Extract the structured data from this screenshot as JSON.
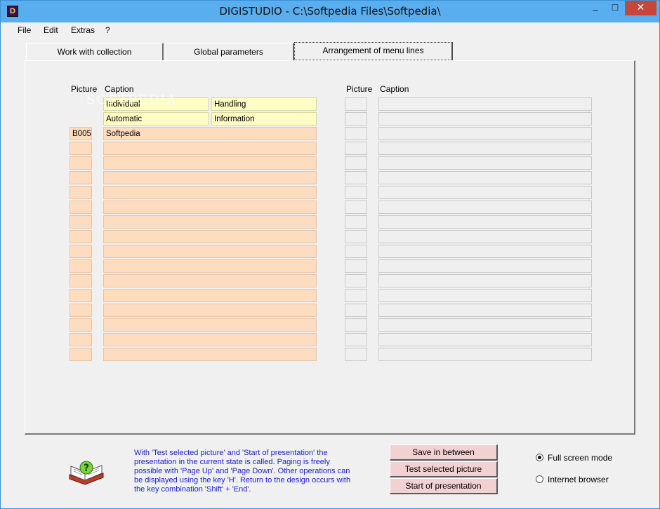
{
  "window": {
    "title": "DIGISTUDIO - C:\\Softpedia Files\\Softpedia\\"
  },
  "menu": [
    "File",
    "Edit",
    "Extras",
    "?"
  ],
  "tabs": [
    "Work with collection",
    "Global parameters",
    "Arrangement of menu lines"
  ],
  "left_table": {
    "header_picture": "Picture",
    "header_caption": "Caption",
    "special_rows": [
      {
        "left": "Individual",
        "right": "Handling"
      },
      {
        "left": "Automatic",
        "right": "Information"
      }
    ],
    "rows": [
      {
        "picture": "B005",
        "caption": "Softpedia"
      },
      {
        "picture": "",
        "caption": ""
      },
      {
        "picture": "",
        "caption": ""
      },
      {
        "picture": "",
        "caption": ""
      },
      {
        "picture": "",
        "caption": ""
      },
      {
        "picture": "",
        "caption": ""
      },
      {
        "picture": "",
        "caption": ""
      },
      {
        "picture": "",
        "caption": ""
      },
      {
        "picture": "",
        "caption": ""
      },
      {
        "picture": "",
        "caption": ""
      },
      {
        "picture": "",
        "caption": ""
      },
      {
        "picture": "",
        "caption": ""
      },
      {
        "picture": "",
        "caption": ""
      },
      {
        "picture": "",
        "caption": ""
      },
      {
        "picture": "",
        "caption": ""
      },
      {
        "picture": "",
        "caption": ""
      }
    ]
  },
  "right_table": {
    "header_picture": "Picture",
    "header_caption": "Caption",
    "row_count": 18
  },
  "watermark": "SOFTPEDIA",
  "help_text": "With 'Test selected picture' and 'Start of presentation' the presentation in the current state is called. Paging is freely possible with 'Page Up' and 'Page Down'. Other operations can be displayed using the key 'H'. Return to the design occurs with the key combination 'Shift' + 'End'.",
  "buttons": [
    "Save in between",
    "Test selected picture",
    "Start of presentation"
  ],
  "radio": {
    "options": [
      "Full screen mode",
      "Internet browser"
    ],
    "selected": "Full screen mode"
  },
  "colors": {
    "title_bar": "#59aef0",
    "close_button": "#c7463b",
    "peach_cell": "#fddcbf",
    "yellow_cell": "#fdfdc4",
    "help_text": "#1a22c8",
    "button_fill": "#f2d1d3"
  },
  "icons": [
    "app-icon",
    "minimize-icon",
    "maximize-icon",
    "close-icon",
    "help-book-icon"
  ]
}
